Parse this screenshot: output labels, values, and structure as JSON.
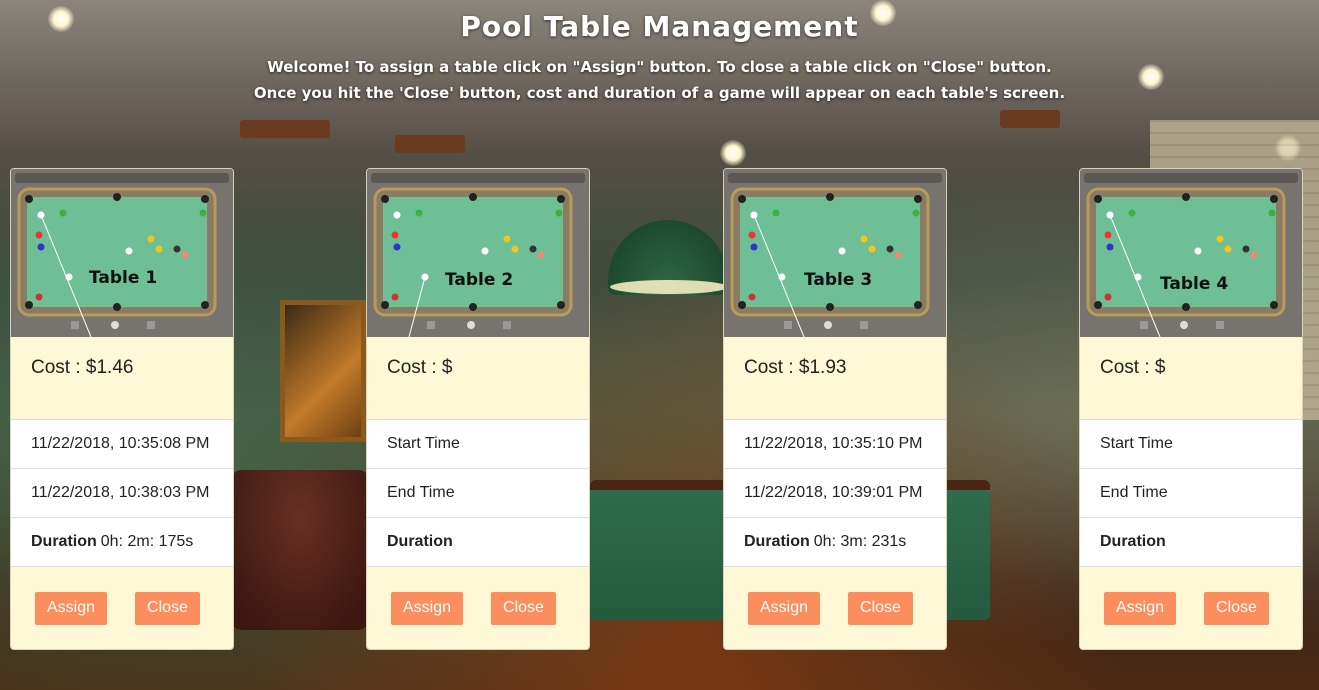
{
  "header": {
    "title": "Pool Table Management",
    "line1": "Welcome! To assign a table click on \"Assign\" button. To close a table click on \"Close\" button.",
    "line2": "Once you hit the 'Close' button, cost and duration of a game will appear on each table's screen."
  },
  "tables": [
    {
      "name": "Table 1",
      "cost_label": "Cost : $1.46",
      "start": "11/22/2018, 10:35:08 PM",
      "end": "11/22/2018, 10:38:03 PM",
      "duration_label": "Duration",
      "duration_value": "0h: 2m: 175s",
      "assign": "Assign",
      "close": "Close"
    },
    {
      "name": "Table 2",
      "cost_label": "Cost : $",
      "start": "Start Time",
      "end": "End Time",
      "duration_label": "Duration",
      "duration_value": "",
      "assign": "Assign",
      "close": "Close"
    },
    {
      "name": "Table 3",
      "cost_label": "Cost : $1.93",
      "start": "11/22/2018, 10:35:10 PM",
      "end": "11/22/2018, 10:39:01 PM",
      "duration_label": "Duration",
      "duration_value": "0h: 3m: 231s",
      "assign": "Assign",
      "close": "Close"
    },
    {
      "name": "Table 4",
      "cost_label": "Cost : $",
      "start": "Start Time",
      "end": "End Time",
      "duration_label": "Duration",
      "duration_value": "",
      "assign": "Assign",
      "close": "Close"
    }
  ],
  "colors": {
    "card_bg": "#fff8d6",
    "button_bg": "#fb8e5c",
    "felt": "#6fbf96"
  }
}
